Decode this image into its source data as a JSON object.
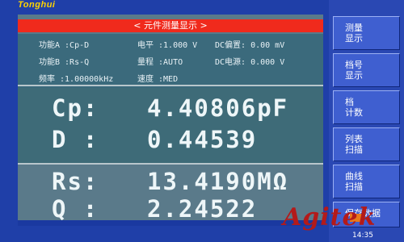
{
  "brand": "Tonghui",
  "title": "< 元件测量显示 >",
  "info": {
    "func_a": "功能A :Cp-D",
    "func_b": "功能B :Rs-Q",
    "freq": "频率  :1.00000kHz",
    "level": "电平  :1.000 V",
    "range": "量程  :AUTO",
    "speed": "速度  :MED",
    "dc_bias": "DC偏置: 0.00   mV",
    "dc_source": "DC电源: 0.000 V"
  },
  "measurements": {
    "primary": {
      "label": "Cp:",
      "value": "4.40806pF"
    },
    "secondary": {
      "label": "D :",
      "value": "0.44539"
    },
    "tertiary": {
      "label": "Rs:",
      "value": "13.4190MΩ"
    },
    "quaternary": {
      "label": "Q :",
      "value": "2.24522"
    }
  },
  "sidebar": {
    "buttons": [
      {
        "line1": "测量",
        "line2": "显示"
      },
      {
        "line1": "档号",
        "line2": "显示"
      },
      {
        "line1": "档",
        "line2": "计数"
      },
      {
        "line1": "列表",
        "line2": "扫描"
      },
      {
        "line1": "曲线",
        "line2": "扫描"
      },
      {
        "line1": "保存数据",
        "line2": ""
      }
    ]
  },
  "clock": "14:35",
  "watermark": "Agitek",
  "colors": {
    "background": "#1f3fa8",
    "panel": "#5a7a8a",
    "title_bar": "#f02a1c",
    "sidebar_button": "#3f5fd0",
    "watermark": "#b31a1a"
  }
}
